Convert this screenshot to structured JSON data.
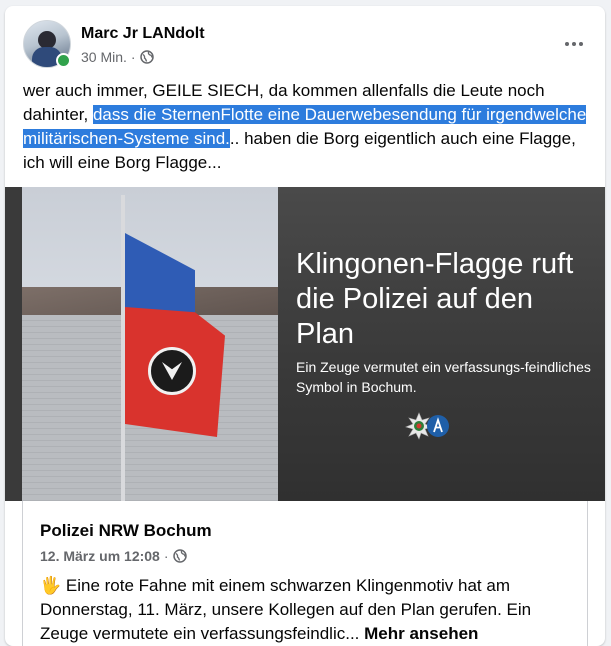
{
  "post": {
    "author": "Marc Jr LANdolt",
    "timestamp": "30 Min.",
    "separator": "·",
    "text_before": "wer auch immer, GEILE SIECH, da kommen allenfalls die Leute noch dahinter, ",
    "text_highlighted": "dass die SternenFlotte eine Dauerwebesendung für irgendwelche militärischen-Systeme sind.",
    "text_after": ".. haben die Borg eigentlich auch eine Flagge, ich will eine Borg Flagge..."
  },
  "image": {
    "headline": "Klingonen-Flagge ruft die Polizei auf den Plan",
    "subline": "Ein Zeuge vermutet ein verfassungs-feindliches Symbol in Bochum."
  },
  "shared": {
    "page_name": "Polizei NRW Bochum",
    "date": "12. März um 12:08",
    "separator": "·",
    "hand_emoji": "🖐",
    "text": " Eine rote Fahne mit einem schwarzen Klingenmotiv hat am Donnerstag, 11. März, unsere Kollegen auf den Plan gerufen. Ein Zeuge vermutete ein verfassungsfeindlic... ",
    "more_label": "Mehr ansehen"
  },
  "colors": {
    "highlight": "#2d7cdd",
    "online": "#31a24c",
    "meta_text": "#65676b"
  },
  "icons": {
    "privacy": "globe-icon",
    "options": "more-options-icon",
    "status": "online-status-icon"
  }
}
